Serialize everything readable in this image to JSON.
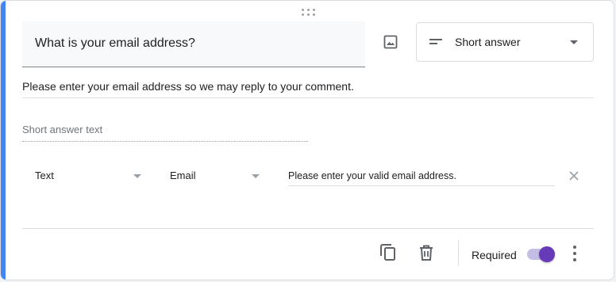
{
  "question": {
    "title": "What is your email address?",
    "type_label": "Short answer",
    "description": "Please enter your email address so we may reply to your comment.",
    "answer_placeholder": "Short answer text"
  },
  "validation": {
    "type": "Text",
    "condition": "Email",
    "error_text": "Please enter your valid email address."
  },
  "footer": {
    "required_label": "Required",
    "required_on": true
  },
  "icons": {
    "image": "image-icon",
    "type": "short-answer-icon",
    "copy": "copy-icon",
    "delete": "trash-icon",
    "clear": "close-icon",
    "more": "more-vert-icon",
    "drag": "drag-handle-icon"
  },
  "colors": {
    "accent": "#4285f4",
    "toggle": "#673ab7"
  }
}
